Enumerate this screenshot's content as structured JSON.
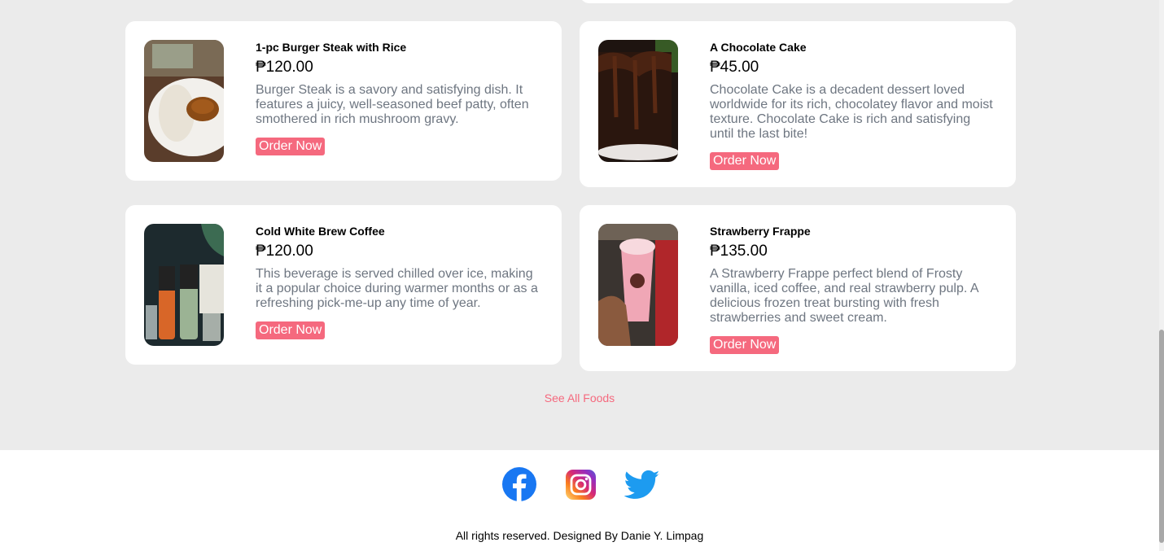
{
  "products": [
    {
      "title": "1-pc Burger Steak with Rice",
      "price": "₱120.00",
      "description": "Burger Steak is a savory and satisfying dish. It features a juicy, well-seasoned beef patty, often smothered in rich mushroom gravy.",
      "button": "Order Now",
      "image": "burger-steak-photo"
    },
    {
      "title": "A Chocolate Cake",
      "price": "₱45.00",
      "description": "Chocolate Cake is a decadent dessert loved worldwide for its rich, chocolatey flavor and moist texture. Chocolate Cake is rich and satisfying until the last bite!",
      "button": "Order Now",
      "image": "chocolate-cake-photo"
    },
    {
      "title": "Cold White Brew Coffee",
      "price": "₱120.00",
      "description": "This beverage is served chilled over ice, making it a popular choice during warmer months or as a refreshing pick-me-up any time of year.",
      "button": "Order Now",
      "image": "cold-brew-bottles-photo"
    },
    {
      "title": "Strawberry Frappe",
      "price": "₱135.00",
      "description": "A Strawberry Frappe perfect blend of Frosty vanilla, iced coffee, and real strawberry pulp. A delicious frozen treat bursting with fresh strawberries and sweet cream.",
      "button": "Order Now",
      "image": "strawberry-frappe-photo"
    }
  ],
  "see_all": "See All Foods",
  "footer": {
    "socials": [
      "facebook-icon",
      "instagram-icon",
      "twitter-icon"
    ],
    "copyright": "All rights reserved. Designed By Danie Y. Limpag"
  },
  "colors": {
    "accent": "#f5697e",
    "background": "#ebebeb",
    "card": "#ffffff",
    "description_text": "#6e7681"
  }
}
